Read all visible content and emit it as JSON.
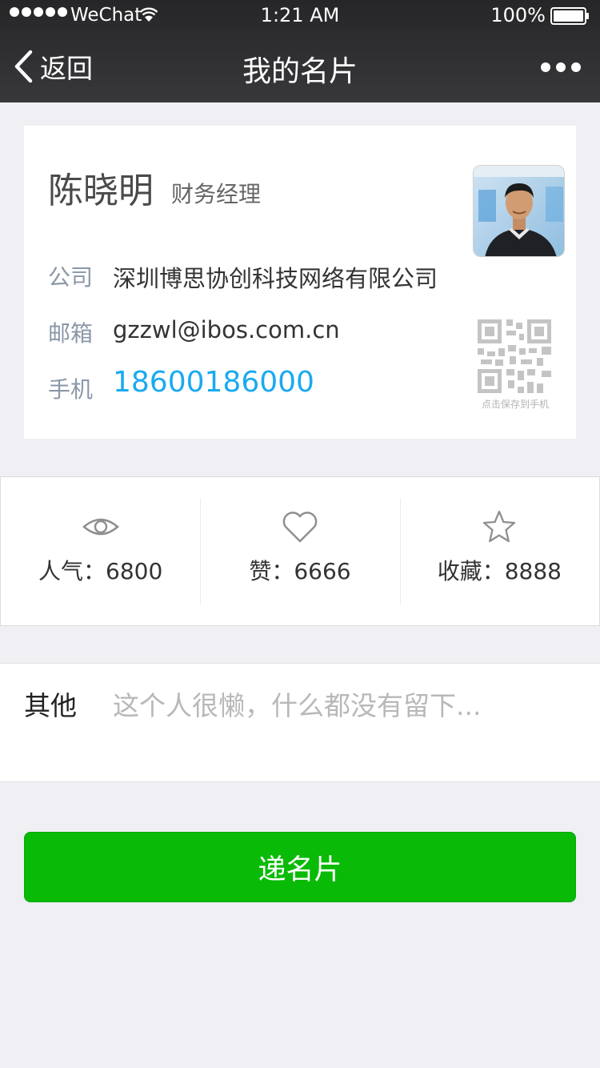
{
  "status_bar": {
    "carrier": "WeChat",
    "time": "1:21 AM",
    "battery": "100%"
  },
  "nav": {
    "back_label": "返回",
    "title": "我的名片"
  },
  "card": {
    "name": "陈晓明",
    "job_title": "财务经理",
    "company_label": "公司",
    "company": "深圳博思协创科技网络有限公司",
    "email_label": "邮箱",
    "email": "gzzwl@ibos.com.cn",
    "phone_label": "手机",
    "phone": "18600186000",
    "qr_caption": "点击保存到手机"
  },
  "stats": [
    {
      "label": "人气：6800",
      "icon": "eye-icon"
    },
    {
      "label": "赞：6666",
      "icon": "heart-icon"
    },
    {
      "label": "收藏：8888",
      "icon": "star-icon"
    }
  ],
  "other": {
    "label": "其他",
    "value": "这个人很懒，什么都没有留下..."
  },
  "send_button": "递名片",
  "colors": {
    "nav_bg": "#2f2f31",
    "accent_green": "#09bb07",
    "phone_blue": "#1aaaf0",
    "page_bg": "#efeff4"
  }
}
